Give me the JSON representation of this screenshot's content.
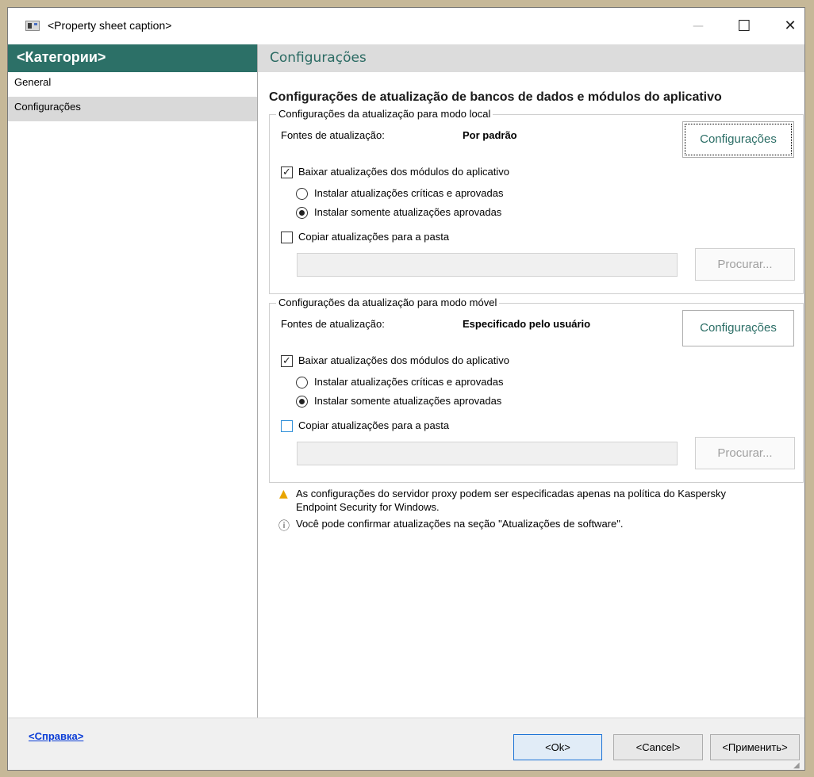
{
  "window": {
    "title": "<Property sheet caption>"
  },
  "sidebar": {
    "header": "<Категории>",
    "items": [
      {
        "label": "General"
      },
      {
        "label": "Configurações"
      }
    ]
  },
  "main": {
    "header": "Configurações",
    "section_title": "Configurações de atualização de bancos de dados e módulos do aplicativo",
    "groups": [
      {
        "legend": "Configurações da atualização para modo local",
        "sources_label": "Fontes de atualização:",
        "sources_value": "Por padrão",
        "config_button": "Configurações",
        "download_label": "Baixar atualizações dos módulos do aplicativo",
        "download_checked": true,
        "radio_critical": "Instalar atualizações críticas e aprovadas",
        "radio_approved": "Instalar somente atualizações aprovadas",
        "selected_radio": "approved",
        "copy_label": "Copiar atualizações para a pasta",
        "copy_checked": false,
        "folder_value": "",
        "browse_button": "Procurar..."
      },
      {
        "legend": "Configurações da atualização para modo móvel",
        "sources_label": "Fontes de atualização:",
        "sources_value": "Especificado pelo usuário",
        "config_button": "Configurações",
        "download_label": "Baixar atualizações dos módulos do aplicativo",
        "download_checked": true,
        "radio_critical": "Instalar atualizações críticas e aprovadas",
        "radio_approved": "Instalar somente atualizações aprovadas",
        "selected_radio": "approved",
        "copy_label": "Copiar atualizações para a pasta",
        "copy_checked": false,
        "folder_value": "",
        "browse_button": "Procurar..."
      }
    ],
    "notes": {
      "warning_line1": "As configurações do servidor proxy podem ser especificadas apenas na política do Kaspersky",
      "warning_line2": "Endpoint Security for Windows.",
      "info": "Você pode confirmar atualizações na seção \"Atualizações de software\"."
    }
  },
  "footer": {
    "help_link": "<Справка>",
    "ok_button": "<Ok>",
    "cancel_button": "<Cancel>",
    "apply_button": "<Применить>"
  },
  "icons": {
    "app": "property-sheet-icon",
    "warning": "warning-triangle-icon",
    "info": "info-circle-icon"
  },
  "colors": {
    "accent": "#2c7067",
    "link": "#0a3cd6",
    "warning": "#e8a400"
  }
}
